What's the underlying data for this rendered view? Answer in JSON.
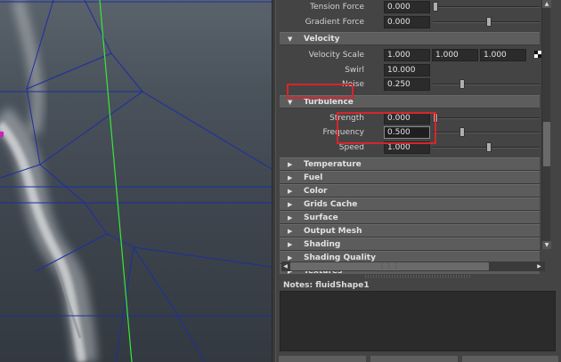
{
  "viewport": {
    "name": "3d-viewport"
  },
  "attributes": {
    "top_rows": [
      {
        "label": "Tension Force",
        "value": "0.000",
        "thumb_fraction": 0.0
      },
      {
        "label": "Gradient Force",
        "value": "0.000",
        "thumb_fraction": 0.5
      }
    ],
    "velocity": {
      "title": "Velocity",
      "scale_label": "Velocity Scale",
      "scale_values": [
        "1.000",
        "1.000",
        "1.000"
      ],
      "swirl_label": "Swirl",
      "swirl_value": "10.000",
      "noise_label": "Noise",
      "noise_value": "0.250",
      "noise_thumb_fraction": 0.25
    },
    "turbulence": {
      "title": "Turbulence",
      "strength_label": "Strength",
      "strength_value": "0.000",
      "strength_thumb_fraction": 0.0,
      "frequency_label": "Frequency",
      "frequency_value": "0.500",
      "frequency_thumb_fraction": 0.25,
      "speed_label": "Speed",
      "speed_value": "1.000",
      "speed_thumb_fraction": 0.5
    },
    "collapsed_sections": [
      "Temperature",
      "Fuel",
      "Color",
      "Grids Cache",
      "Surface",
      "Output Mesh",
      "Shading",
      "Shading Quality",
      "Textures"
    ]
  },
  "notes": {
    "label": "Notes:  fluidShape1",
    "text": ""
  },
  "colors": {
    "highlight_box": "#d6262c",
    "wire_blue": "#1c2fa0",
    "axis_green": "#39e639"
  },
  "icons": {
    "expanded": "triangle-down-icon",
    "collapsed": "triangle-right-icon"
  }
}
